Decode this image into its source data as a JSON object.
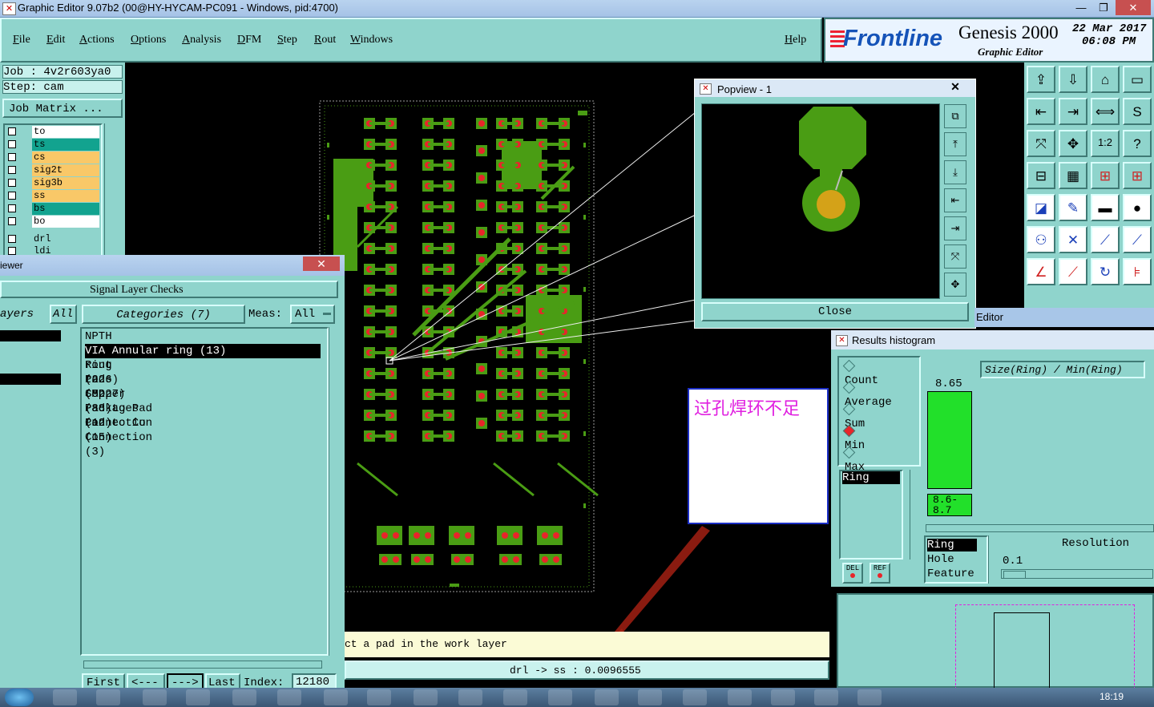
{
  "window": {
    "title": "Graphic Editor 9.07b2 (00@HY-HYCAM-PC091 - Windows, pid:4700)",
    "min": "—",
    "max": "❐",
    "close": "✕"
  },
  "menu": {
    "items": [
      "File",
      "Edit",
      "Actions",
      "Options",
      "Analysis",
      "DFM",
      "Step",
      "Rout",
      "Windows"
    ],
    "help": "Help"
  },
  "logo": {
    "brand": "Frontline",
    "product": "Genesis 2000",
    "subtitle": "Graphic Editor",
    "date": "22 Mar 2017",
    "time": "06:08 PM"
  },
  "job": {
    "job_label": "Job : 4v2r603ya0",
    "step_label": "Step: cam",
    "matrix_button": "Job Matrix ..."
  },
  "layers": [
    {
      "name": "to",
      "color": "#ffffff"
    },
    {
      "name": "ts",
      "color": "#12a38f"
    },
    {
      "name": "cs",
      "color": "#f9c868"
    },
    {
      "name": "sig2t",
      "color": "#f9c868"
    },
    {
      "name": "sig3b",
      "color": "#f9c868"
    },
    {
      "name": "ss",
      "color": "#f9c868"
    },
    {
      "name": "bs",
      "color": "#12a38f"
    },
    {
      "name": "bo",
      "color": "#ffffff"
    },
    {
      "name": "drl",
      "color": "#8fd4cc"
    },
    {
      "name": "ldi",
      "color": "#8fd4cc"
    }
  ],
  "checks": {
    "viewer_tab": "iewer",
    "title": "Signal Layer Checks",
    "layers_label": "ayers",
    "all_button": "All",
    "categories_button": "Categories (7)",
    "meas_label": "Meas:",
    "meas_value": "All",
    "categories": [
      "NPTH Annular ring (226)",
      "VIA Annular ring (13)",
      "Rout to Copper (88)",
      "Pads (8227)",
      "SMD Packages (12)",
      "Pad to Pad Connection (15)",
      "Pad to Cu Connection (3)"
    ],
    "selected_index": 1,
    "nav": {
      "first": "First",
      "prev": "<---",
      "next": "--->",
      "last": "Last",
      "index_label": "Index:",
      "index_value": "12180"
    }
  },
  "popview": {
    "title": "Popview - 1",
    "close_button": "Close"
  },
  "note": {
    "text": "过孔焊环不足"
  },
  "histogram": {
    "editor_tab": "Editor",
    "title": "Results histogram",
    "modes": [
      "Count",
      "Average",
      "Sum",
      "Min",
      "Max"
    ],
    "selected_mode": "Min",
    "axis_label": "Size(Ring) / Min(Ring)",
    "bar_value": "8.65",
    "bin_label": "8.6-8.7",
    "list_item": "Ring",
    "del_button": "DEL",
    "ref_button": "REF",
    "feature_list": [
      "Ring",
      "Hole",
      "Feature"
    ],
    "resolution_label": "Resolution",
    "resolution_value": "0.1"
  },
  "status": {
    "prompt": "ct a pad in the work layer",
    "measure": "drl -> ss : 0.0096555"
  },
  "taskbar": {
    "time": "18:19"
  },
  "colors": {
    "panel": "#8fd4cc",
    "copper": "#4a9d14",
    "pad_red": "#e8252a",
    "histo_bar": "#22e02a",
    "note_text": "#e020e0"
  }
}
